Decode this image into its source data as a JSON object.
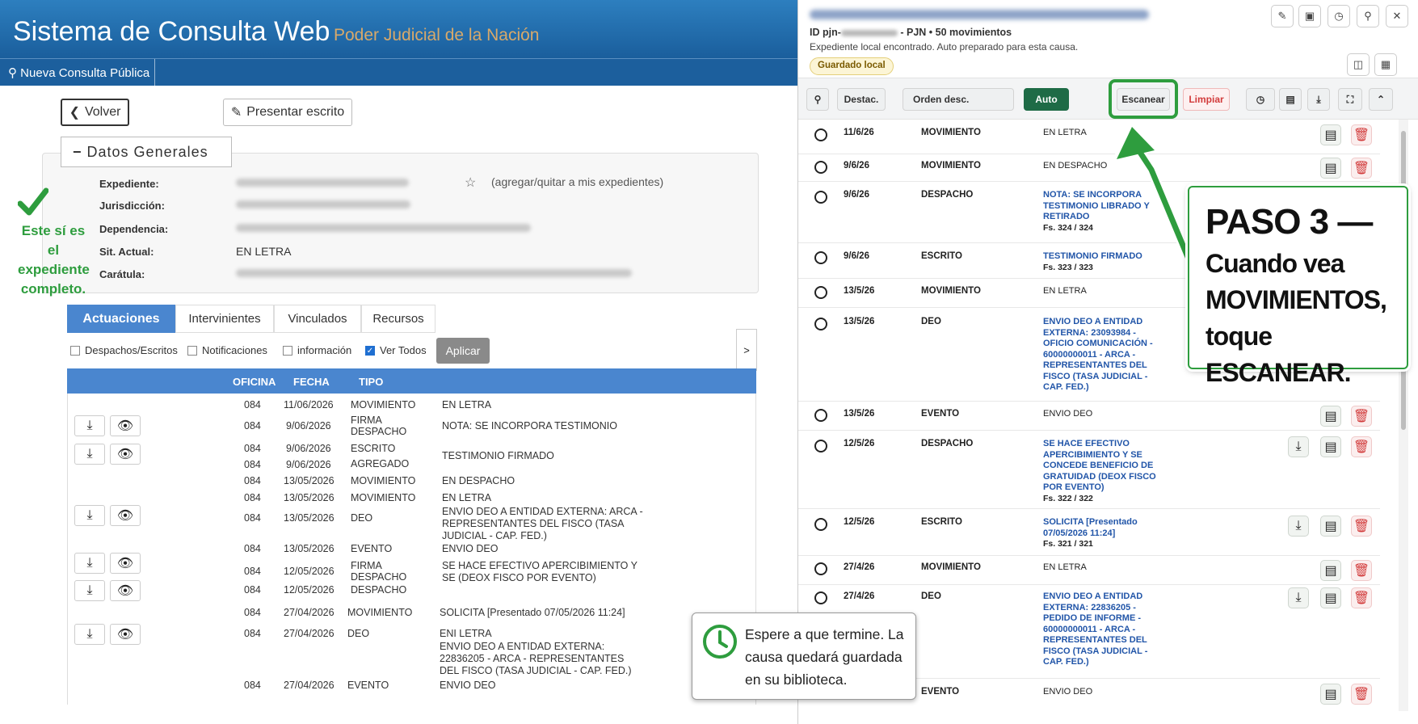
{
  "left": {
    "header": {
      "title": "Sistema de Consulta Web",
      "subtitle": "Poder Judicial de la Nación"
    },
    "nav": {
      "public_query": "Nueva Consulta Pública"
    },
    "buttons": {
      "back": "Volver",
      "submit_brief": "Presentar escrito"
    },
    "general": {
      "title": "Datos Generales",
      "labels": {
        "file": "Expediente:",
        "jurisdiction": "Jurisdicción:",
        "dependency": "Dependencia:",
        "status": "Sit. Actual:",
        "cover": "Carátula:"
      },
      "status_value": "EN LETRA",
      "favorite": "(agregar/quitar a mis expedientes)"
    },
    "note": "Este sí es el expediente completo.",
    "tabs": [
      "Actuaciones",
      "Intervinientes",
      "Vinculados",
      "Recursos"
    ],
    "filters": {
      "dispatches": "Despachos/Escritos",
      "notifications": "Notificaciones",
      "info": "información",
      "all": "Ver Todos",
      "apply": "Aplicar"
    },
    "table": {
      "headers": {
        "office": "OFICINA",
        "date": "FECHA",
        "type": "TIPO"
      },
      "rows": [
        {
          "office": "084",
          "date": "11/06/2026",
          "type": "MOVIMIENTO",
          "desc": "EN LETRA"
        },
        {
          "office": "084",
          "date": "9/06/2026",
          "type": "FIRMA DESPACHO",
          "desc": "NOTA: SE INCORPORA TESTIMONIO"
        },
        {
          "office": "084",
          "date": "9/06/2026",
          "type": "ESCRITO",
          "desc": "TESTIMONIO FIRMADO"
        },
        {
          "office": "084",
          "date": "9/06/2026",
          "type": "AGREGADO",
          "desc": ""
        },
        {
          "office": "084",
          "date": "13/05/2026",
          "type": "MOVIMIENTO",
          "desc": "EN DESPACHO"
        },
        {
          "office": "084",
          "date": "13/05/2026",
          "type": "MOVIMIENTO",
          "desc": "EN LETRA"
        },
        {
          "office": "084",
          "date": "13/05/2026",
          "type": "DEO",
          "desc": "ENVIO DEO A ENTIDAD EXTERNA: ARCA - REPRESENTANTES DEL FISCO (TASA JUDICIAL - CAP. FED.)"
        },
        {
          "office": "084",
          "date": "13/05/2026",
          "type": "EVENTO",
          "desc": "ENVIO DEO"
        },
        {
          "office": "084",
          "date": "12/05/2026",
          "type": "FIRMA DESPACHO",
          "desc": "SE HACE EFECTIVO APERCIBIMIENTO Y SE (DEOX FISCO POR EVENTO)"
        },
        {
          "office": "084",
          "date": "12/05/2026",
          "type": "DESPACHO",
          "desc": ""
        },
        {
          "office": "084",
          "date": "27/04/2026",
          "type": "MOVIMIENTO",
          "desc": "SOLICITA [Presentado 07/05/2026 11:24]"
        },
        {
          "office": "084",
          "date": "27/04/2026",
          "type": "DEO",
          "desc": "ENI LETRA"
        },
        {
          "office": "",
          "date": "",
          "type": "",
          "desc": "ENVIO DEO A ENTIDAD EXTERNA: 22836205 - ARCA - REPRESENTANTES DEL FISCO (TASA JUDICIAL - CAP. FED.)"
        },
        {
          "office": "084",
          "date": "27/04/2026",
          "type": "EVENTO",
          "desc": "ENVIO DEO"
        }
      ]
    }
  },
  "panel": {
    "id_prefix": "ID pjn-",
    "id_suffix": "- PJN • 50 movimientos",
    "info": "Expediente local encontrado. Auto preparado para esta causa.",
    "badge": "Guardado local",
    "toolbar": {
      "highlight": "Destac.",
      "order": "Orden desc.",
      "auto": "Auto",
      "scan": "Escanear",
      "clear": "Limpiar"
    },
    "rows": [
      {
        "date": "11/6/26",
        "type": "MOVIMIENTO",
        "desc": "EN LETRA",
        "fs": ""
      },
      {
        "date": "9/6/26",
        "type": "MOVIMIENTO",
        "desc": "EN DESPACHO",
        "fs": ""
      },
      {
        "date": "9/6/26",
        "type": "DESPACHO",
        "desc": "NOTA: SE INCORPORA TESTIMONIO LIBRADO Y RETIRADO",
        "fs": "Fs. 324 / 324"
      },
      {
        "date": "9/6/26",
        "type": "ESCRITO",
        "desc": "TESTIMONIO FIRMADO",
        "fs": "Fs. 323 / 323"
      },
      {
        "date": "13/5/26",
        "type": "MOVIMIENTO",
        "desc": "EN LETRA",
        "fs": ""
      },
      {
        "date": "13/5/26",
        "type": "DEO",
        "desc": "ENVIO DEO A ENTIDAD EXTERNA: 23093984 - OFICIO COMUNICACIÓN - 60000000011 - ARCA - REPRESENTANTES DEL FISCO (TASA JUDICIAL - CAP. FED.)",
        "fs": ""
      },
      {
        "date": "13/5/26",
        "type": "EVENTO",
        "desc": "ENVIO DEO",
        "fs": ""
      },
      {
        "date": "12/5/26",
        "type": "DESPACHO",
        "desc": "SE HACE EFECTIVO APERCIBIMIENTO Y SE CONCEDE BENEFICIO DE GRATUIDAD (DEOX FISCO POR EVENTO)",
        "fs": "Fs. 322 / 322"
      },
      {
        "date": "12/5/26",
        "type": "ESCRITO",
        "desc": "SOLICITA [Presentado 07/05/2026 11:24]",
        "fs": "Fs. 321 / 321"
      },
      {
        "date": "27/4/26",
        "type": "MOVIMIENTO",
        "desc": "EN LETRA",
        "fs": ""
      },
      {
        "date": "27/4/26",
        "type": "DEO",
        "desc": "ENVIO DEO A ENTIDAD EXTERNA: 22836205 - PEDIDO DE INFORME - 60000000011 - ARCA - REPRESENTANTES DEL FISCO (TASA JUDICIAL - CAP. FED.)",
        "fs": ""
      },
      {
        "date": "",
        "type": "EVENTO",
        "desc": "ENVIO DEO",
        "fs": ""
      }
    ]
  },
  "callout": {
    "title": "PASO 3 —",
    "body": "Cuando vea MOVIMIENTOS, toque ESCANEAR."
  },
  "tip": {
    "text": "Espere a que termine. La causa quedará guardada en su biblioteca."
  },
  "colors": {
    "brand_blue": "#1c5f9d",
    "guide_green": "#2e9d3e",
    "auto_green": "#1e6b46",
    "clear_red": "#d23b3b",
    "link_blue": "#2155a8"
  }
}
